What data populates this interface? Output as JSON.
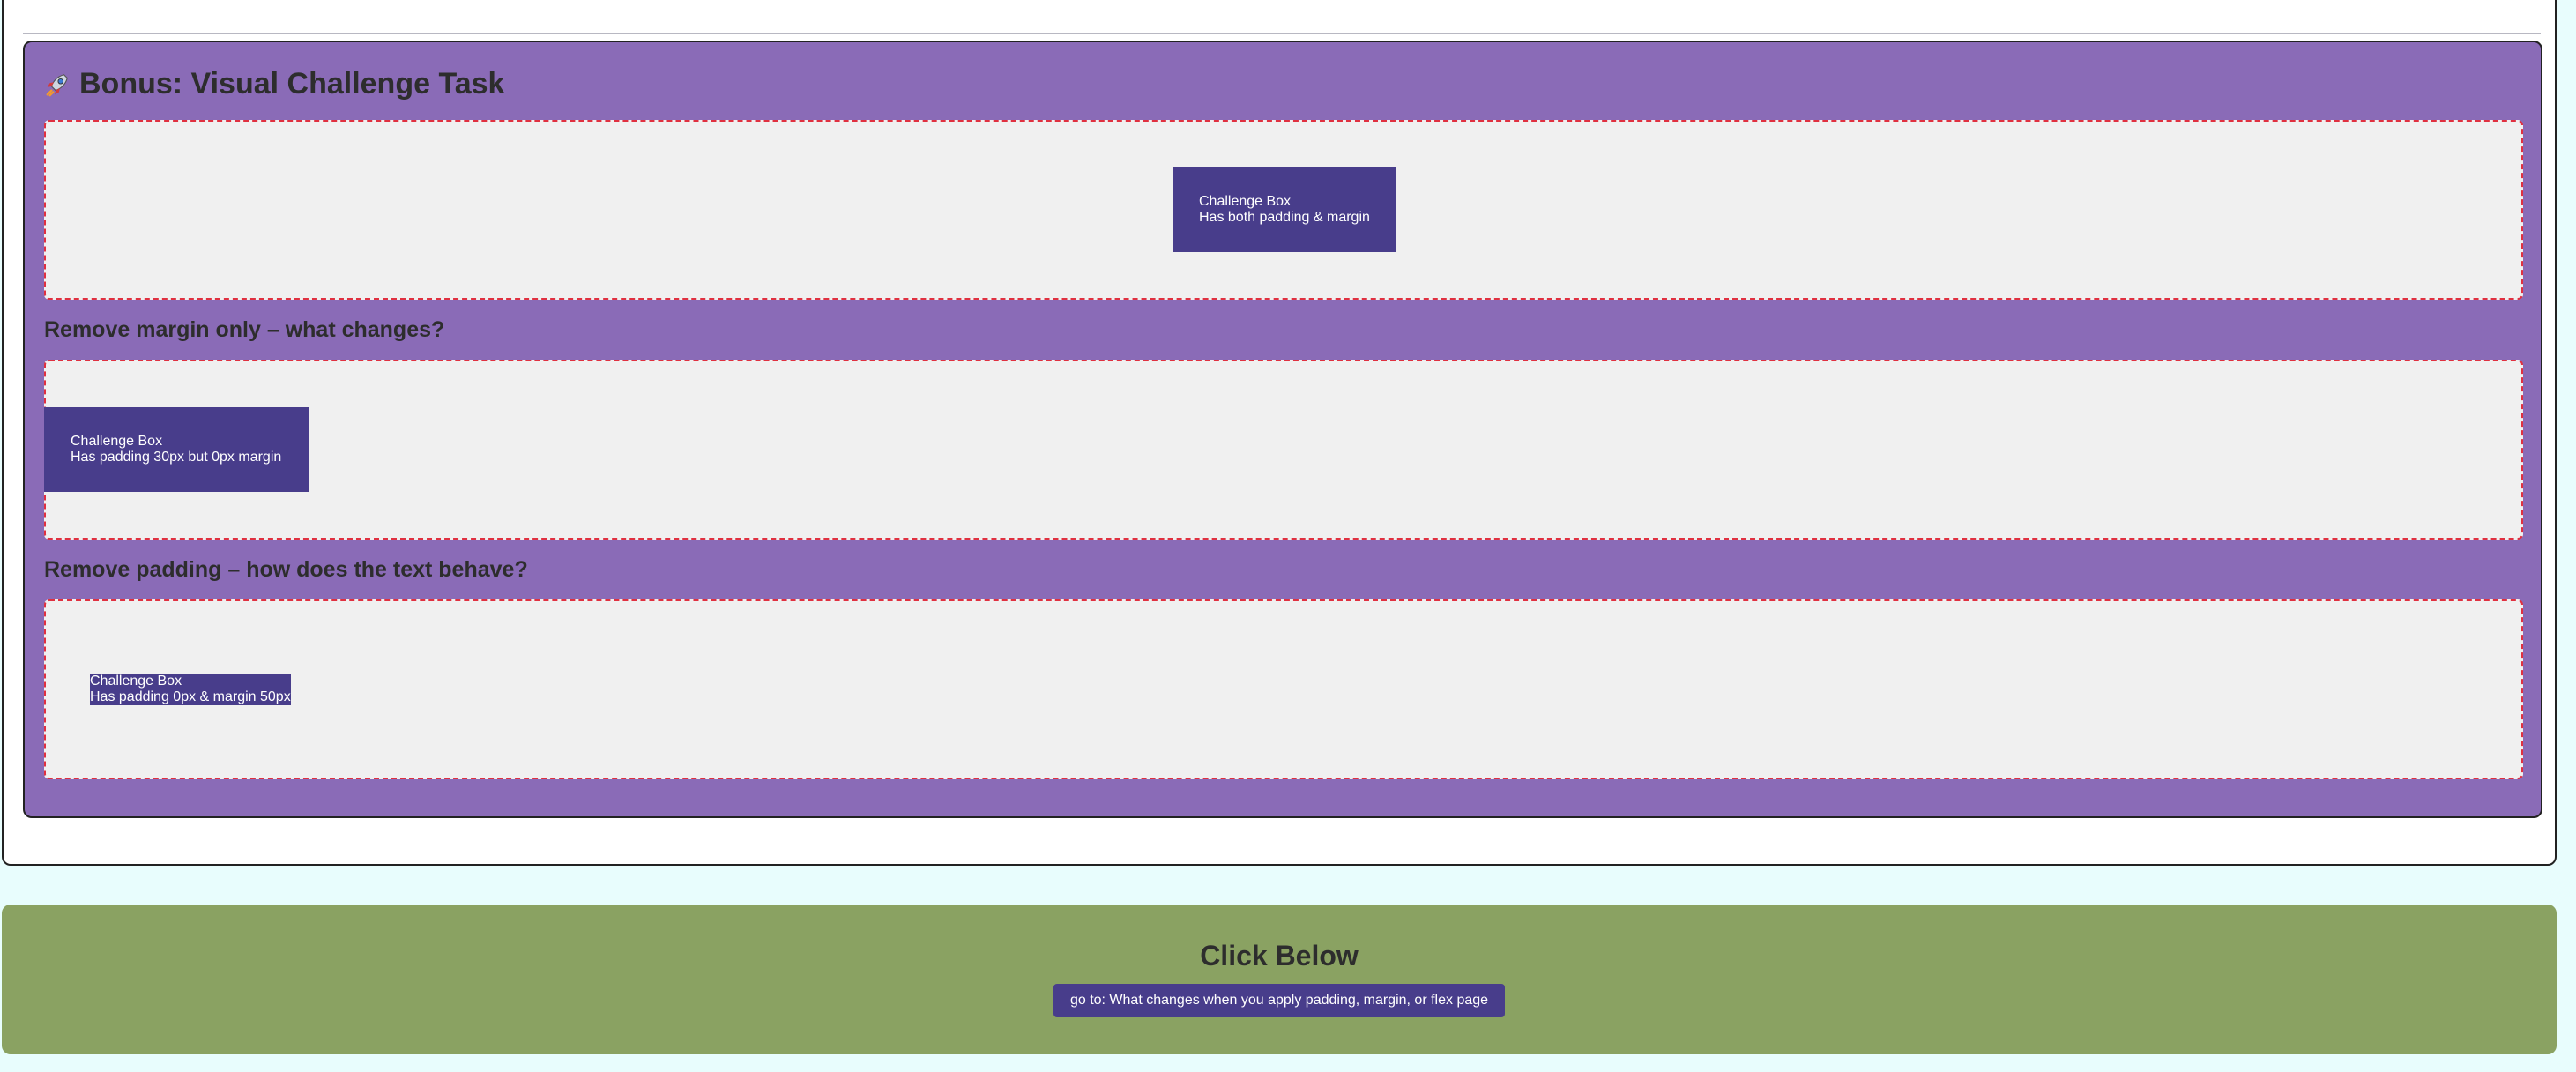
{
  "bonus": {
    "icon": "rocket-icon",
    "title": "Bonus: Visual Challenge Task",
    "demos": [
      {
        "box_title": "Challenge Box",
        "box_desc": "Has both padding & margin"
      },
      {
        "question": "Remove margin only – what changes?",
        "box_title": "Challenge Box",
        "box_desc": "Has padding 30px but 0px margin"
      },
      {
        "question": "Remove padding – how does the text behave?",
        "box_title": "Challenge Box",
        "box_desc": "Has padding 0px & margin 50px"
      }
    ]
  },
  "footer": {
    "title": "Click Below",
    "button_label": "go to: What changes when you apply padding, margin, or flex page"
  },
  "colors": {
    "page_bg": "#e8fdfd",
    "section_bg": "#8a6bb7",
    "challenge_box": "#483d8b",
    "demo_bg": "#f0f0f0",
    "demo_border": "#e03040",
    "footer_bg": "#8aa262"
  }
}
